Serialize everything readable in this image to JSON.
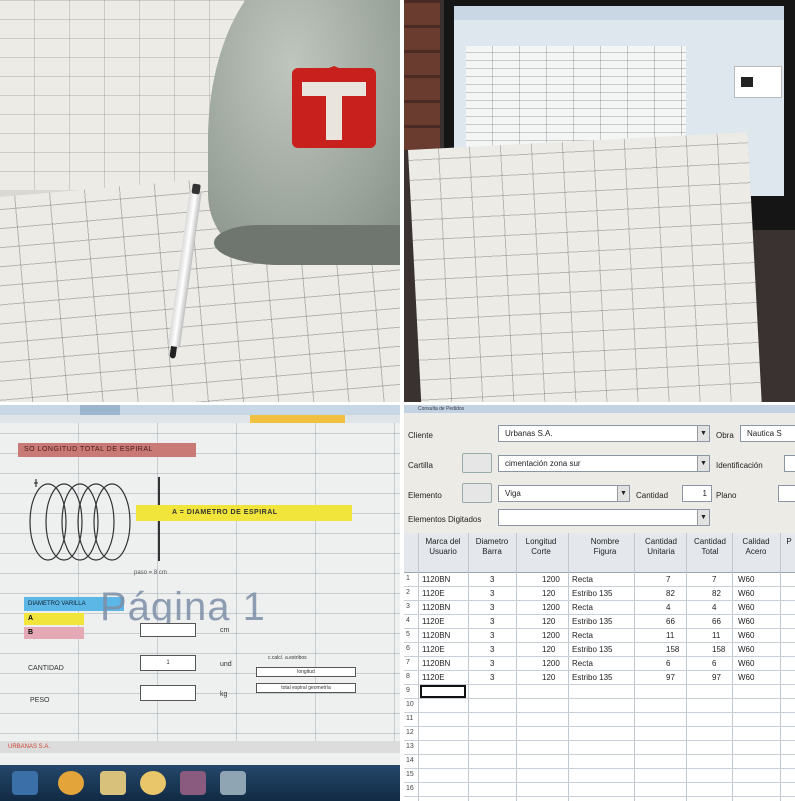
{
  "spreadsheet_page": {
    "banner": "SO LONGITUD TOTAL DE ESPIRAL",
    "diameter_label": "A = DIAMETRO DE ESPIRAL",
    "pitch_label": "paso = 8 cm",
    "page_watermark": "Página 1",
    "cell_blue": "DIAMETRO VARILLA",
    "cell_a": "A",
    "cell_b": "B",
    "unit_cm": "cm",
    "cantidad_label": "CANTIDAD",
    "cantidad_value": "1",
    "unit_und": "und",
    "peso_label": "PESO",
    "unit_kg": "kg",
    "note_1": "c.calc/. a.estribos",
    "note_2": "longitud",
    "note_3": "total espiral geometría",
    "sheet_tab": "URBANAS S.A."
  },
  "form": {
    "header": "Consulta de Pedidos",
    "cliente_label": "Cliente",
    "cliente_value": "Urbanas S.A.",
    "obra_label": "Obra",
    "obra_value": "Nautica S",
    "cartilla_label": "Cartilla",
    "cartilla_value": "cimentación zona sur",
    "identificacion_label": "Identificación",
    "elemento_label": "Elemento",
    "elemento_value": "Viga",
    "cantidad_label": "Cantidad",
    "cantidad_value": "1",
    "plano_label": "Plano",
    "elementos_digitados_label": "Elementos Digitados"
  },
  "table": {
    "headers": [
      "Marca del Usuario",
      "Diametro Barra",
      "Longitud Corte",
      "Nombre Figura",
      "Cantidad Unitaria",
      "Cantidad Total",
      "Calidad Acero",
      "P"
    ],
    "rows": [
      {
        "n": "1",
        "marca": "1120BN",
        "diam": "3",
        "long": "1200",
        "fig": "Recta",
        "cu": "7",
        "ct": "7",
        "acero": "W60"
      },
      {
        "n": "2",
        "marca": "1120E",
        "diam": "3",
        "long": "120",
        "fig": "Estribo 135",
        "cu": "82",
        "ct": "82",
        "acero": "W60"
      },
      {
        "n": "3",
        "marca": "1120BN",
        "diam": "3",
        "long": "1200",
        "fig": "Recta",
        "cu": "4",
        "ct": "4",
        "acero": "W60"
      },
      {
        "n": "4",
        "marca": "1120E",
        "diam": "3",
        "long": "120",
        "fig": "Estribo 135",
        "cu": "66",
        "ct": "66",
        "acero": "W60"
      },
      {
        "n": "5",
        "marca": "1120BN",
        "diam": "3",
        "long": "1200",
        "fig": "Recta",
        "cu": "11",
        "ct": "11",
        "acero": "W60"
      },
      {
        "n": "6",
        "marca": "1120E",
        "diam": "3",
        "long": "120",
        "fig": "Estribo 135",
        "cu": "158",
        "ct": "158",
        "acero": "W60"
      },
      {
        "n": "7",
        "marca": "1120BN",
        "diam": "3",
        "long": "1200",
        "fig": "Recta",
        "cu": "6",
        "ct": "6",
        "acero": "W60"
      },
      {
        "n": "8",
        "marca": "1120E",
        "diam": "3",
        "long": "120",
        "fig": "Estribo 135",
        "cu": "97",
        "ct": "97",
        "acero": "W60"
      }
    ],
    "empty_row_numbers": [
      "9",
      "10",
      "11",
      "12",
      "13",
      "14",
      "15",
      "16"
    ]
  },
  "colors": {
    "helmet_logo": "#c8201c",
    "highlight_yellow": "#f1e43a",
    "highlight_blue": "#5cb7e6",
    "highlight_pink": "#e4a9b4"
  }
}
